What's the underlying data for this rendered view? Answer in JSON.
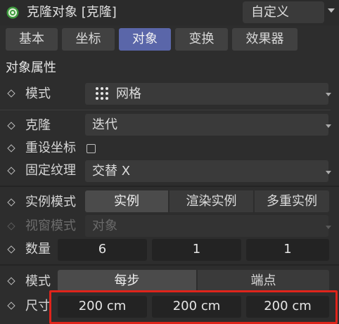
{
  "header": {
    "title": "克隆对象 [克隆]",
    "preset": "自定义"
  },
  "tabs": [
    {
      "label": "基本",
      "active": false
    },
    {
      "label": "坐标",
      "active": false
    },
    {
      "label": "对象",
      "active": true
    },
    {
      "label": "变换",
      "active": false
    },
    {
      "label": "效果器",
      "active": false
    }
  ],
  "section_title": "对象属性",
  "fields": {
    "mode": {
      "label": "模式",
      "value": "网格",
      "icon": "grid-dots-icon"
    },
    "clone": {
      "label": "克隆",
      "value": "迭代"
    },
    "reset_coords": {
      "label": "重设坐标",
      "checked": false
    },
    "fix_texture": {
      "label": "固定纹理",
      "value": "交替 X"
    },
    "instance_mode": {
      "label": "实例模式",
      "options": [
        "实例",
        "渲染实例",
        "多重实例"
      ],
      "selected": "实例"
    },
    "viewport_mode": {
      "label": "视窗模式",
      "value": "对象",
      "enabled": false
    },
    "count": {
      "label": "数量",
      "values": [
        "6",
        "1",
        "1"
      ]
    },
    "step_mode": {
      "label": "模式",
      "options": [
        "每步",
        "端点"
      ],
      "selected": "每步"
    },
    "size": {
      "label": "尺寸",
      "values": [
        "200 cm",
        "200 cm",
        "200 cm"
      ]
    }
  },
  "colors": {
    "active_tab": "#5a66a9",
    "highlight": "#e0241b",
    "background": "#2d2d2d"
  }
}
